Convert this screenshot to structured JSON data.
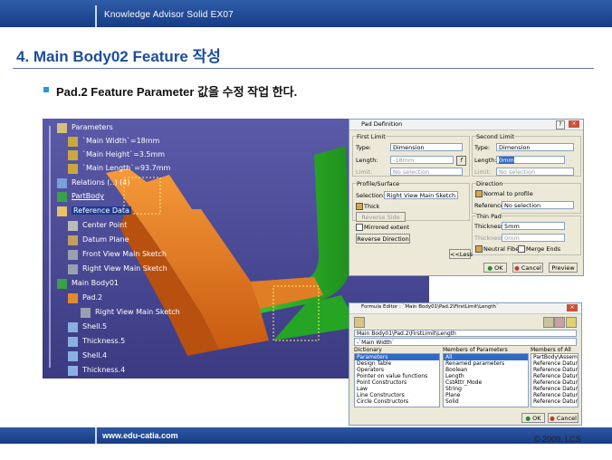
{
  "header": {
    "title": "Knowledge Advisor Solid  EX07"
  },
  "heading": "4. Main Body02 Feature 작성",
  "bullet": "Pad.2 Feature Parameter 값을 수정 작업 한다.",
  "tree": {
    "items": [
      {
        "label": "Parameters"
      },
      {
        "label": "`Main Width`=18mm"
      },
      {
        "label": "`Main Height`=3.5mm"
      },
      {
        "label": "`Main Length`=93.7mm"
      },
      {
        "label": "Relations (..) (4)"
      },
      {
        "label": "PartBody"
      },
      {
        "label": "Reference Data"
      },
      {
        "label": "Center Point"
      },
      {
        "label": "Datum Plane"
      },
      {
        "label": "Front View Main Sketch"
      },
      {
        "label": "Right View Main Sketch"
      },
      {
        "label": "Main Body01"
      },
      {
        "label": "Pad.2"
      },
      {
        "label": "Right View Main Sketch"
      },
      {
        "label": "Shell.5"
      },
      {
        "label": "Thickness.5"
      },
      {
        "label": "Shell.4"
      },
      {
        "label": "Thickness.4"
      }
    ]
  },
  "pad_dialog": {
    "title": "Pad Definition",
    "first_limit": "First Limit",
    "second_limit": "Second Limit",
    "type_label": "Type:",
    "type_value": "Dimension",
    "type2_value": "Dimension",
    "length_label": "Length:",
    "length_value": "-18mm",
    "length2_value": "0mm",
    "limit_label": "Limit:",
    "limit_value": "No selection",
    "limit2_value": "No selection",
    "profile_surface": "Profile/Surface",
    "selection_label": "Selection:",
    "selection_value": "Right View Main Sketch",
    "thick": "Thick",
    "reverse_side": "Reverse Side",
    "mirrored_extent": "Mirrored extent",
    "reverse_direction": "Reverse Direction",
    "direction": "Direction",
    "normal_to_profile": "Normal to profile",
    "reference_label": "Reference:",
    "reference_value": "No selection",
    "thin_pad": "Thin Pad",
    "thickness1_label": "Thickness1:",
    "thickness1_value": "5mm",
    "thickness2_label": "Thickness2:",
    "thickness2_value": "0mm",
    "neutral_fiber": "Neutral Fiber",
    "merge_ends": "Merge Ends",
    "less_button": "<<Less",
    "ok": "OK",
    "cancel": "Cancel",
    "preview": "Preview"
  },
  "formula_dialog": {
    "title": "Formula Editor : `Main Body01\\Pad.2\\FirstLimit\\Length`",
    "path_value": "Main Body01\\Pad.2\\FirstLimit\\Length",
    "formula_value": "-`Main Width`",
    "dictionary_label": "Dictionary",
    "members_params_label": "Members of Parameters",
    "members_all_label": "Members of All",
    "dictionary": [
      "Parameters",
      "Design Table",
      "Operators",
      "Pointer on value functions",
      "Point Constructors",
      "Law",
      "Line Constructors",
      "Circle Constructors"
    ],
    "members_params": [
      "All",
      "Renamed parameters",
      "Boolean",
      "Length",
      "CstAttr_Mode",
      "String",
      "Plane",
      "Solid"
    ],
    "members_all": [
      "PartBody\\Assem..",
      "Reference Datum",
      "Reference Datum",
      "Reference Datum",
      "Reference Datum",
      "Reference Datum",
      "Reference Datum",
      "Reference Datum"
    ],
    "ok": "OK",
    "cancel": "Cancel"
  },
  "footer": {
    "url": "www.edu-catia.com",
    "copyright": "© 2009. LCS"
  }
}
